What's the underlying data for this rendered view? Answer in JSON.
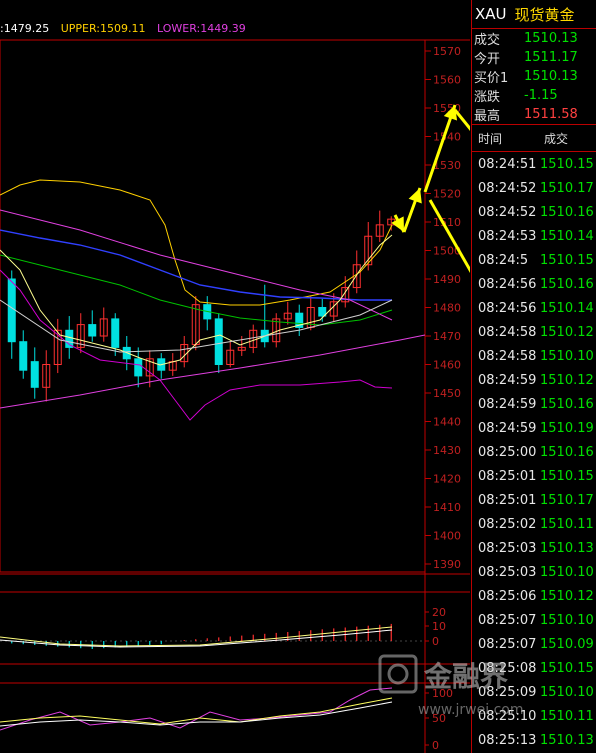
{
  "chart_header": {
    "mid": ":1479.25",
    "upper": "UPPER:1509.11",
    "lower": "LOWER:1449.39"
  },
  "price_axis": [
    "1570",
    "1560",
    "1550",
    "1540",
    "1530",
    "1520",
    "1510",
    "1500",
    "1490",
    "1480",
    "1470",
    "1460",
    "1450",
    "1440",
    "1430",
    "1420",
    "1410",
    "1400",
    "1390"
  ],
  "macd_axis": [
    "20",
    "10",
    "0"
  ],
  "kdj_axis": [
    "100",
    "50",
    "0"
  ],
  "quote_panel": {
    "code": "XAU",
    "name": "现货黄金",
    "rows": [
      {
        "label": "成交",
        "value": "1510.13",
        "color": "#00e000"
      },
      {
        "label": "今开",
        "value": "1511.17",
        "color": "#00e000"
      },
      {
        "label": "买价1",
        "value": "1510.13",
        "color": "#00e000"
      },
      {
        "label": "涨跌",
        "value": "-1.15",
        "color": "#00e000"
      },
      {
        "label": "最高",
        "value": "1511.58",
        "color": "#ff4040"
      }
    ]
  },
  "ticks_header": {
    "time": "时间",
    "price": "成交"
  },
  "ticks": [
    {
      "time": "08:24:51",
      "price": "1510.15"
    },
    {
      "time": "08:24:52",
      "price": "1510.17"
    },
    {
      "time": "08:24:52",
      "price": "1510.16"
    },
    {
      "time": "08:24:53",
      "price": "1510.14"
    },
    {
      "time": "08:24:5",
      "price": "1510.15"
    },
    {
      "time": "08:24:56",
      "price": "1510.16"
    },
    {
      "time": "08:24:56",
      "price": "1510.14"
    },
    {
      "time": "08:24:58",
      "price": "1510.12"
    },
    {
      "time": "08:24:58",
      "price": "1510.10"
    },
    {
      "time": "08:24:59",
      "price": "1510.12"
    },
    {
      "time": "08:24:59",
      "price": "1510.16"
    },
    {
      "time": "08:24:59",
      "price": "1510.19"
    },
    {
      "time": "08:25:00",
      "price": "1510.16"
    },
    {
      "time": "08:25:01",
      "price": "1510.15"
    },
    {
      "time": "08:25:01",
      "price": "1510.17"
    },
    {
      "time": "08:25:02",
      "price": "1510.11"
    },
    {
      "time": "08:25:03",
      "price": "1510.13"
    },
    {
      "time": "08:25:03",
      "price": "1510.10"
    },
    {
      "time": "08:25:06",
      "price": "1510.12"
    },
    {
      "time": "08:25:07",
      "price": "1510.10"
    },
    {
      "time": "08:25:07",
      "price": "1510.09"
    },
    {
      "time": "08:25:08",
      "price": "1510.15"
    },
    {
      "time": "08:25:09",
      "price": "1510.10"
    },
    {
      "time": "08:25:10",
      "price": "1510.11"
    },
    {
      "time": "08:25:13",
      "price": "1510.13"
    }
  ],
  "watermark": {
    "brand": "金融界",
    "url": "www.jrwei.com"
  },
  "colors": {
    "up": "#ff3030",
    "down": "#00e0e0",
    "upper": "#ffd000",
    "lower": "#d000d0",
    "tick_price": "#00e000",
    "arrow": "#ffff00"
  }
}
